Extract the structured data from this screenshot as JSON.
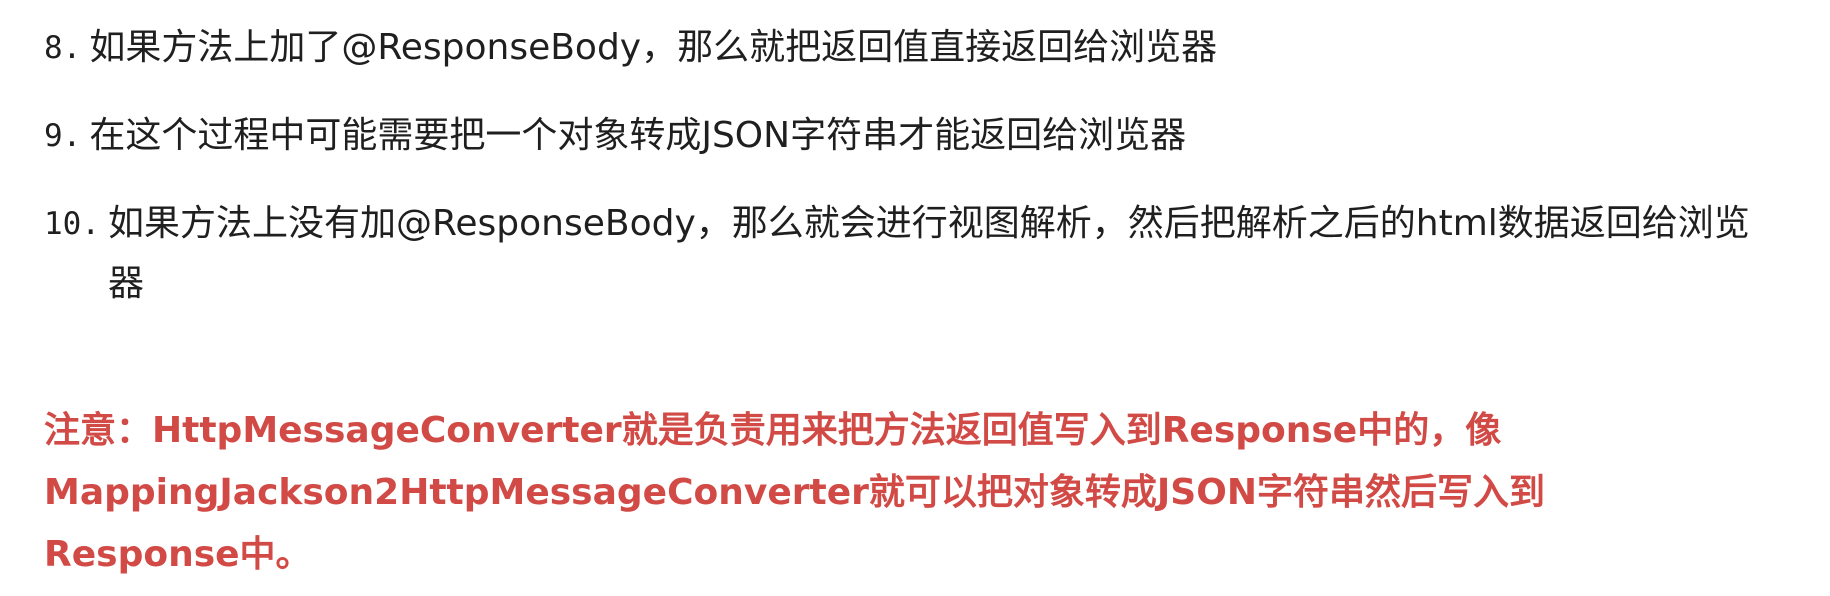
{
  "list": [
    {
      "number": "8.",
      "text": "如果方法上加了@ResponseBody，那么就把返回值直接返回给浏览器"
    },
    {
      "number": "9.",
      "text": "在这个过程中可能需要把一个对象转成JSON字符串才能返回给浏览器"
    },
    {
      "number": "10.",
      "text": "如果方法上没有加@ResponseBody，那么就会进行视图解析，然后把解析之后的html数据返回给浏览器"
    }
  ],
  "note": {
    "text": "注意：HttpMessageConverter就是负责用来把方法返回值写入到Response中的，像MappingJackson2HttpMessageConverter就可以把对象转成JSON字符串然后写入到Response中。",
    "color": "#d24a45"
  }
}
